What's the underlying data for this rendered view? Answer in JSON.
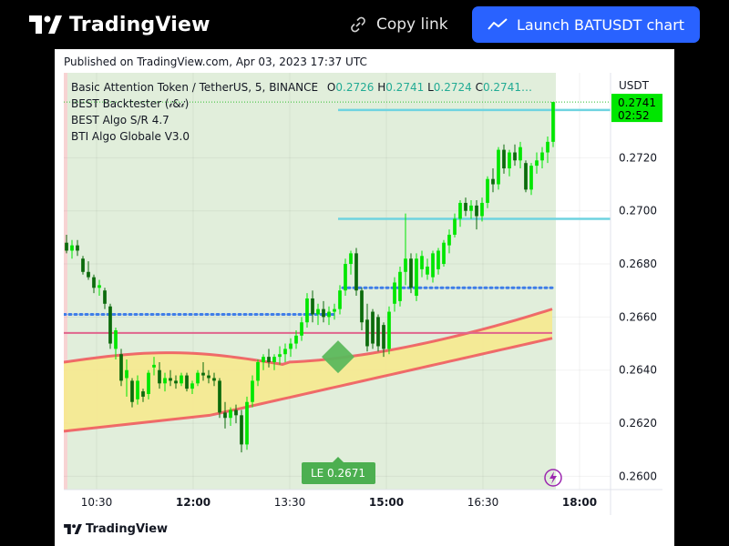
{
  "header": {
    "brand": "TradingView",
    "copy_link_label": "Copy link",
    "launch_button_label": "Launch BATUSDT chart"
  },
  "published_text": "Published on TradingView.com, Apr 03, 2023 17:37 UTC",
  "legend": {
    "symbol_line": "Basic Attention Token / TetherUS, 5, BINANCE",
    "open_label": "O",
    "open_value": "0.2726",
    "high_label": "H",
    "high_value": "0.2741",
    "low_label": "L",
    "low_value": "0.2724",
    "close_label": "C",
    "close_value": "0.2741…",
    "indicators": [
      "BEST Backtester (𝒾&𝒾)",
      "BEST Algo S/R 4.7",
      "BTI Algo Globale V3.0"
    ]
  },
  "price_axis": {
    "currency": "USDT",
    "ticks": [
      "0.2720",
      "0.2700",
      "0.2680",
      "0.2660",
      "0.2640",
      "0.2620",
      "0.2600"
    ],
    "current_price": "0.2741",
    "countdown": "02:52"
  },
  "time_axis": {
    "ticks": [
      "10:30",
      "12:00",
      "13:30",
      "15:00",
      "16:30",
      "18:00"
    ]
  },
  "entry_label": "LE 0.2671",
  "footer_brand": "TradingView",
  "colors": {
    "up": "#00e600",
    "down": "#0b6b0b",
    "bg_tint": "#e1eedb",
    "support_line": "#6fd3e0",
    "dotted_line": "#3f7de8",
    "band_fill": "#f6e98e",
    "band_edge": "#f0545a",
    "pink_line": "#e0648c",
    "accent_blue": "#2962ff"
  },
  "chart_data": {
    "type": "candlestick",
    "symbol": "BATUSDT",
    "interval": "5",
    "exchange": "BINANCE",
    "y_range": [
      0.2595,
      0.2752
    ],
    "time_ticks": [
      "10:30",
      "12:00",
      "13:30",
      "15:00",
      "16:30",
      "18:00"
    ],
    "price_ticks": [
      0.272,
      0.27,
      0.268,
      0.266,
      0.264,
      0.262,
      0.26
    ],
    "last_bar": {
      "open": 0.2726,
      "high": 0.2741,
      "low": 0.2724,
      "close": 0.2741
    },
    "candles": [
      {
        "o": 0.2688,
        "h": 0.2691,
        "l": 0.2684,
        "c": 0.2685
      },
      {
        "o": 0.2685,
        "h": 0.2689,
        "l": 0.2682,
        "c": 0.2687
      },
      {
        "o": 0.2687,
        "h": 0.2689,
        "l": 0.2683,
        "c": 0.2685
      },
      {
        "o": 0.2682,
        "h": 0.2683,
        "l": 0.2676,
        "c": 0.2677
      },
      {
        "o": 0.2677,
        "h": 0.2681,
        "l": 0.2674,
        "c": 0.2675
      },
      {
        "o": 0.2675,
        "h": 0.2676,
        "l": 0.2669,
        "c": 0.2671
      },
      {
        "o": 0.2671,
        "h": 0.2674,
        "l": 0.2668,
        "c": 0.2672
      },
      {
        "o": 0.267,
        "h": 0.2671,
        "l": 0.2663,
        "c": 0.2665
      },
      {
        "o": 0.2664,
        "h": 0.2665,
        "l": 0.2648,
        "c": 0.265
      },
      {
        "o": 0.2648,
        "h": 0.2656,
        "l": 0.2644,
        "c": 0.2655
      },
      {
        "o": 0.2646,
        "h": 0.2648,
        "l": 0.2634,
        "c": 0.2636
      },
      {
        "o": 0.2637,
        "h": 0.2644,
        "l": 0.263,
        "c": 0.264
      },
      {
        "o": 0.2636,
        "h": 0.2637,
        "l": 0.2626,
        "c": 0.2628
      },
      {
        "o": 0.2629,
        "h": 0.2638,
        "l": 0.2627,
        "c": 0.2636
      },
      {
        "o": 0.2632,
        "h": 0.2633,
        "l": 0.2628,
        "c": 0.263
      },
      {
        "o": 0.2631,
        "h": 0.264,
        "l": 0.2629,
        "c": 0.2639
      },
      {
        "o": 0.2641,
        "h": 0.2645,
        "l": 0.2638,
        "c": 0.2642
      },
      {
        "o": 0.264,
        "h": 0.2643,
        "l": 0.2633,
        "c": 0.2635
      },
      {
        "o": 0.2635,
        "h": 0.2639,
        "l": 0.2632,
        "c": 0.2637
      },
      {
        "o": 0.2637,
        "h": 0.264,
        "l": 0.2634,
        "c": 0.2636
      },
      {
        "o": 0.2636,
        "h": 0.2638,
        "l": 0.2633,
        "c": 0.2635
      },
      {
        "o": 0.2635,
        "h": 0.2639,
        "l": 0.2634,
        "c": 0.2638
      },
      {
        "o": 0.2638,
        "h": 0.2639,
        "l": 0.2632,
        "c": 0.2633
      },
      {
        "o": 0.2633,
        "h": 0.2636,
        "l": 0.2631,
        "c": 0.2635
      },
      {
        "o": 0.2635,
        "h": 0.264,
        "l": 0.2634,
        "c": 0.2639
      },
      {
        "o": 0.2639,
        "h": 0.2643,
        "l": 0.2636,
        "c": 0.2638
      },
      {
        "o": 0.2638,
        "h": 0.264,
        "l": 0.2635,
        "c": 0.2637
      },
      {
        "o": 0.2637,
        "h": 0.2639,
        "l": 0.2634,
        "c": 0.2636
      },
      {
        "o": 0.2636,
        "h": 0.2637,
        "l": 0.2622,
        "c": 0.2624
      },
      {
        "o": 0.2624,
        "h": 0.2628,
        "l": 0.2618,
        "c": 0.2622
      },
      {
        "o": 0.2622,
        "h": 0.2626,
        "l": 0.2619,
        "c": 0.2625
      },
      {
        "o": 0.2625,
        "h": 0.2627,
        "l": 0.262,
        "c": 0.2623
      },
      {
        "o": 0.2623,
        "h": 0.2625,
        "l": 0.2609,
        "c": 0.2612
      },
      {
        "o": 0.2612,
        "h": 0.263,
        "l": 0.261,
        "c": 0.2628
      },
      {
        "o": 0.2628,
        "h": 0.2638,
        "l": 0.2626,
        "c": 0.2636
      },
      {
        "o": 0.2636,
        "h": 0.2644,
        "l": 0.2634,
        "c": 0.2643
      },
      {
        "o": 0.2643,
        "h": 0.2646,
        "l": 0.264,
        "c": 0.2645
      },
      {
        "o": 0.2645,
        "h": 0.2648,
        "l": 0.2641,
        "c": 0.2643
      },
      {
        "o": 0.2643,
        "h": 0.2646,
        "l": 0.264,
        "c": 0.2645
      },
      {
        "o": 0.2645,
        "h": 0.2649,
        "l": 0.2642,
        "c": 0.2646
      },
      {
        "o": 0.2646,
        "h": 0.265,
        "l": 0.2643,
        "c": 0.2648
      },
      {
        "o": 0.2648,
        "h": 0.2652,
        "l": 0.2645,
        "c": 0.265
      },
      {
        "o": 0.265,
        "h": 0.2655,
        "l": 0.2648,
        "c": 0.2653
      },
      {
        "o": 0.2653,
        "h": 0.266,
        "l": 0.2651,
        "c": 0.2658
      },
      {
        "o": 0.2658,
        "h": 0.2669,
        "l": 0.2656,
        "c": 0.2667
      },
      {
        "o": 0.2667,
        "h": 0.267,
        "l": 0.2658,
        "c": 0.2661
      },
      {
        "o": 0.2661,
        "h": 0.2665,
        "l": 0.2657,
        "c": 0.2663
      },
      {
        "o": 0.2663,
        "h": 0.2666,
        "l": 0.2658,
        "c": 0.266
      },
      {
        "o": 0.266,
        "h": 0.2664,
        "l": 0.2657,
        "c": 0.2662
      },
      {
        "o": 0.2662,
        "h": 0.2665,
        "l": 0.2659,
        "c": 0.2663
      },
      {
        "o": 0.2663,
        "h": 0.2672,
        "l": 0.2661,
        "c": 0.267
      },
      {
        "o": 0.267,
        "h": 0.2682,
        "l": 0.2668,
        "c": 0.268
      },
      {
        "o": 0.268,
        "h": 0.2685,
        "l": 0.2676,
        "c": 0.2684
      },
      {
        "o": 0.2684,
        "h": 0.2686,
        "l": 0.2668,
        "c": 0.267
      },
      {
        "o": 0.267,
        "h": 0.2671,
        "l": 0.2655,
        "c": 0.2658
      },
      {
        "o": 0.2659,
        "h": 0.2665,
        "l": 0.2647,
        "c": 0.2649
      },
      {
        "o": 0.2662,
        "h": 0.2663,
        "l": 0.2648,
        "c": 0.265
      },
      {
        "o": 0.266,
        "h": 0.2661,
        "l": 0.2647,
        "c": 0.2649
      },
      {
        "o": 0.2657,
        "h": 0.2658,
        "l": 0.2645,
        "c": 0.2648
      },
      {
        "o": 0.2648,
        "h": 0.2664,
        "l": 0.2646,
        "c": 0.2662
      },
      {
        "o": 0.2665,
        "h": 0.2675,
        "l": 0.2662,
        "c": 0.2673
      },
      {
        "o": 0.2666,
        "h": 0.2679,
        "l": 0.2664,
        "c": 0.2677
      },
      {
        "o": 0.2677,
        "h": 0.2699,
        "l": 0.2672,
        "c": 0.2682
      },
      {
        "o": 0.2682,
        "h": 0.2684,
        "l": 0.2669,
        "c": 0.2671
      },
      {
        "o": 0.2668,
        "h": 0.2684,
        "l": 0.2666,
        "c": 0.2682
      },
      {
        "o": 0.2678,
        "h": 0.2685,
        "l": 0.2675,
        "c": 0.2683
      },
      {
        "o": 0.2676,
        "h": 0.2682,
        "l": 0.2674,
        "c": 0.2679
      },
      {
        "o": 0.2675,
        "h": 0.2685,
        "l": 0.2673,
        "c": 0.2684
      },
      {
        "o": 0.2678,
        "h": 0.2686,
        "l": 0.2676,
        "c": 0.2685
      },
      {
        "o": 0.268,
        "h": 0.2689,
        "l": 0.2679,
        "c": 0.2688
      },
      {
        "o": 0.2687,
        "h": 0.2693,
        "l": 0.2684,
        "c": 0.2691
      },
      {
        "o": 0.2691,
        "h": 0.2699,
        "l": 0.269,
        "c": 0.2697
      },
      {
        "o": 0.2697,
        "h": 0.2704,
        "l": 0.2694,
        "c": 0.2703
      },
      {
        "o": 0.2703,
        "h": 0.2705,
        "l": 0.2698,
        "c": 0.27
      },
      {
        "o": 0.27,
        "h": 0.2704,
        "l": 0.2697,
        "c": 0.2702
      },
      {
        "o": 0.2702,
        "h": 0.2704,
        "l": 0.2693,
        "c": 0.2698
      },
      {
        "o": 0.2698,
        "h": 0.2705,
        "l": 0.2696,
        "c": 0.2703
      },
      {
        "o": 0.2703,
        "h": 0.2713,
        "l": 0.2701,
        "c": 0.2712
      },
      {
        "o": 0.2712,
        "h": 0.2716,
        "l": 0.2707,
        "c": 0.271
      },
      {
        "o": 0.271,
        "h": 0.2724,
        "l": 0.2708,
        "c": 0.2723
      },
      {
        "o": 0.2723,
        "h": 0.2725,
        "l": 0.2714,
        "c": 0.2716
      },
      {
        "o": 0.2716,
        "h": 0.2723,
        "l": 0.2713,
        "c": 0.2722
      },
      {
        "o": 0.2722,
        "h": 0.2725,
        "l": 0.2717,
        "c": 0.2719
      },
      {
        "o": 0.2719,
        "h": 0.2726,
        "l": 0.2716,
        "c": 0.2724
      },
      {
        "o": 0.2718,
        "h": 0.2719,
        "l": 0.2707,
        "c": 0.2708
      },
      {
        "o": 0.2708,
        "h": 0.2718,
        "l": 0.2706,
        "c": 0.2717
      },
      {
        "o": 0.2717,
        "h": 0.2722,
        "l": 0.2714,
        "c": 0.2719
      },
      {
        "o": 0.2719,
        "h": 0.2724,
        "l": 0.2716,
        "c": 0.2722
      },
      {
        "o": 0.2722,
        "h": 0.2728,
        "l": 0.2718,
        "c": 0.2726
      },
      {
        "o": 0.2726,
        "h": 0.2741,
        "l": 0.2724,
        "c": 0.2741
      }
    ],
    "levels": {
      "support_upper": 0.2738,
      "support_lower": 0.2697,
      "dotted_left": 0.2661,
      "dotted_right": 0.2671,
      "pink_line": 0.2654,
      "entry": 0.2671
    }
  }
}
